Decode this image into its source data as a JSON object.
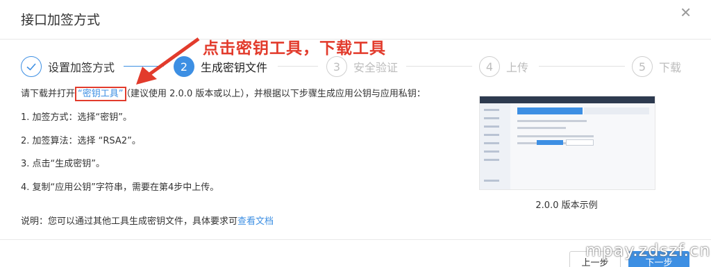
{
  "dialog": {
    "title": "接口加签方式",
    "close_icon": "close-icon"
  },
  "annotation": {
    "text": "点击密钥工具，下载工具",
    "color": "#e23b2c"
  },
  "steps": [
    {
      "number": "",
      "label": "设置加签方式",
      "state": "done"
    },
    {
      "number": "2",
      "label": "生成密钥文件",
      "state": "active"
    },
    {
      "number": "3",
      "label": "安全验证",
      "state": "todo"
    },
    {
      "number": "4",
      "label": "上传",
      "state": "todo"
    },
    {
      "number": "5",
      "label": "下载",
      "state": "todo"
    }
  ],
  "content": {
    "intro_prefix": "请下载并打开",
    "tool_link": "“密钥工具”",
    "intro_suffix": "（建议使用 2.0.0 版本或以上），并根据以下步骤生成应用公钥与应用私钥：",
    "items": [
      "1. 加签方式：选择“密钥”。",
      "2. 加签算法：选择 “RSA2”。",
      "3. 点击“生成密钥”。",
      "4. 复制“应用公钥”字符串，需要在第4步中上传。"
    ],
    "note_prefix": "说明：您可以通过其他工具生成密钥文件，具体要求可",
    "doc_link": "查看文档"
  },
  "preview": {
    "caption": "2.0.0 版本示例"
  },
  "footer": {
    "prev_label": "上一步",
    "next_label": "下一步"
  },
  "watermark": "mpay.zdszf.cn",
  "colors": {
    "accent": "#3d8fe3",
    "annotation_red": "#e23b2c"
  }
}
